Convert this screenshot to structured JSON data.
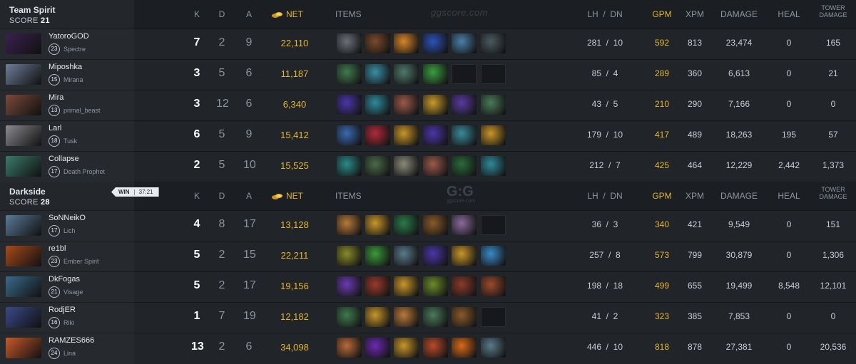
{
  "headers": {
    "k": "K",
    "d": "D",
    "a": "A",
    "net": "NET",
    "items": "ITEMS",
    "lh_dn": "LH  /  DN",
    "gpm": "GPM",
    "xpm": "XPM",
    "damage": "DAMAGE",
    "heal": "HEAL",
    "tower_damage_1": "TOWER",
    "tower_damage_2": "DAMAGE"
  },
  "watermark_top": "ggscore.com",
  "watermark_mid": "G:G",
  "watermark_mid_sub": "ggscore.com",
  "result": {
    "label": "WIN",
    "duration": "37:21"
  },
  "colors": {
    "gold": "#e2b632",
    "bg": "#1d2024",
    "text": "#c7cdd3"
  },
  "teams": [
    {
      "name": "Team Spirit",
      "score_label": "SCORE",
      "score": "21",
      "players": [
        {
          "name": "YatoroGOD",
          "level": "23",
          "hero": "Spectre",
          "k": "7",
          "d": "2",
          "a": "9",
          "net": "22,110",
          "lh": "281",
          "dn": "10",
          "gpm": "592",
          "xpm": "813",
          "damage": "23,474",
          "heal": "0",
          "tower": "165",
          "portrait": "#3a2150",
          "items": [
            "#6b6f78",
            "#7a4a2a",
            "#d6862a",
            "#2b52b8",
            "#4a7fa8",
            "#4a5a5e"
          ]
        },
        {
          "name": "Miposhka",
          "level": "15",
          "hero": "Mirana",
          "k": "3",
          "d": "5",
          "a": "6",
          "net": "11,187",
          "lh": "85",
          "dn": "4",
          "gpm": "289",
          "xpm": "360",
          "damage": "6,613",
          "heal": "0",
          "tower": "21",
          "portrait": "#6d7d9a",
          "items": [
            "#3f7a4e",
            "#3a8fa4",
            "#4d7a6a",
            "#3b9d42",
            "",
            ""
          ]
        },
        {
          "name": "Mira",
          "level": "13",
          "hero": "primal_beast",
          "k": "3",
          "d": "12",
          "a": "6",
          "net": "6,340",
          "lh": "43",
          "dn": "5",
          "gpm": "210",
          "xpm": "290",
          "damage": "7,166",
          "heal": "0",
          "tower": "0",
          "portrait": "#7a4a3a",
          "items": [
            "#4b36a8",
            "#2f8a9a",
            "#9a5a4a",
            "#c89a2a",
            "#5a3aa0",
            "#4a7a5a"
          ]
        },
        {
          "name": "Larl",
          "level": "18",
          "hero": "Tusk",
          "k": "6",
          "d": "5",
          "a": "9",
          "net": "15,412",
          "lh": "179",
          "dn": "10",
          "gpm": "417",
          "xpm": "489",
          "damage": "18,263",
          "heal": "195",
          "tower": "57",
          "portrait": "#8a8a90",
          "items": [
            "#3a6ab0",
            "#b02a3a",
            "#c8962a",
            "#4b36a8",
            "#3a8a9a",
            "#c8962a"
          ]
        },
        {
          "name": "Collapse",
          "level": "17",
          "hero": "Death Prophet",
          "k": "2",
          "d": "5",
          "a": "10",
          "net": "15,525",
          "lh": "212",
          "dn": "7",
          "gpm": "425",
          "xpm": "464",
          "damage": "12,229",
          "heal": "2,442",
          "tower": "1,373",
          "portrait": "#3a7a6a",
          "items": [
            "#2a8a8a",
            "#4a6a4a",
            "#8a8a7a",
            "#9a5a4a",
            "#2a6a3a",
            "#2f8a9a"
          ]
        }
      ]
    },
    {
      "name": "Darkside",
      "score_label": "SCORE",
      "score": "28",
      "players": [
        {
          "name": "SoNNeikO",
          "level": "17",
          "hero": "Lich",
          "k": "4",
          "d": "8",
          "a": "17",
          "net": "13,128",
          "lh": "36",
          "dn": "3",
          "gpm": "340",
          "xpm": "421",
          "damage": "9,549",
          "heal": "0",
          "tower": "151",
          "portrait": "#5a7a9a",
          "items": [
            "#b87a3a",
            "#c8962a",
            "#2a7a4a",
            "#8a5a2a",
            "#8a6a9a",
            ""
          ]
        },
        {
          "name": "re1bl",
          "level": "23",
          "hero": "Ember Spirit",
          "k": "5",
          "d": "2",
          "a": "15",
          "net": "22,211",
          "lh": "257",
          "dn": "8",
          "gpm": "573",
          "xpm": "799",
          "damage": "30,879",
          "heal": "0",
          "tower": "1,306",
          "portrait": "#a84a1a",
          "items": [
            "#8a8a2a",
            "#3a9a3a",
            "#5a7a8a",
            "#4b36a8",
            "#c8962a",
            "#3a8ac8"
          ]
        },
        {
          "name": "DkFogas",
          "level": "21",
          "hero": "Visage",
          "k": "5",
          "d": "2",
          "a": "17",
          "net": "19,156",
          "lh": "198",
          "dn": "18",
          "gpm": "499",
          "xpm": "655",
          "damage": "19,499",
          "heal": "8,548",
          "tower": "12,101",
          "portrait": "#3a6a8a",
          "items": [
            "#6a3ab0",
            "#9a3a2a",
            "#c8962a",
            "#6a8a2a",
            "#8a3a2a",
            "#9a4a2a"
          ]
        },
        {
          "name": "RodjER",
          "level": "16",
          "hero": "Riki",
          "k": "1",
          "d": "7",
          "a": "19",
          "net": "12,182",
          "lh": "41",
          "dn": "2",
          "gpm": "323",
          "xpm": "385",
          "damage": "7,853",
          "heal": "0",
          "tower": "0",
          "portrait": "#3a4a8a",
          "items": [
            "#3f7a4e",
            "#c8962a",
            "#b87a3a",
            "#4a7a5a",
            "#8a5a2a",
            ""
          ]
        },
        {
          "name": "RAMZES666",
          "level": "24",
          "hero": "Lina",
          "k": "13",
          "d": "2",
          "a": "6",
          "net": "34,098",
          "lh": "446",
          "dn": "10",
          "gpm": "818",
          "xpm": "878",
          "damage": "27,381",
          "heal": "0",
          "tower": "20,536",
          "portrait": "#c85a2a",
          "items": [
            "#b86a3a",
            "#6a2ab0",
            "#c8962a",
            "#b84a2a",
            "#d86a1a",
            "#5a7a8a"
          ]
        }
      ]
    }
  ]
}
